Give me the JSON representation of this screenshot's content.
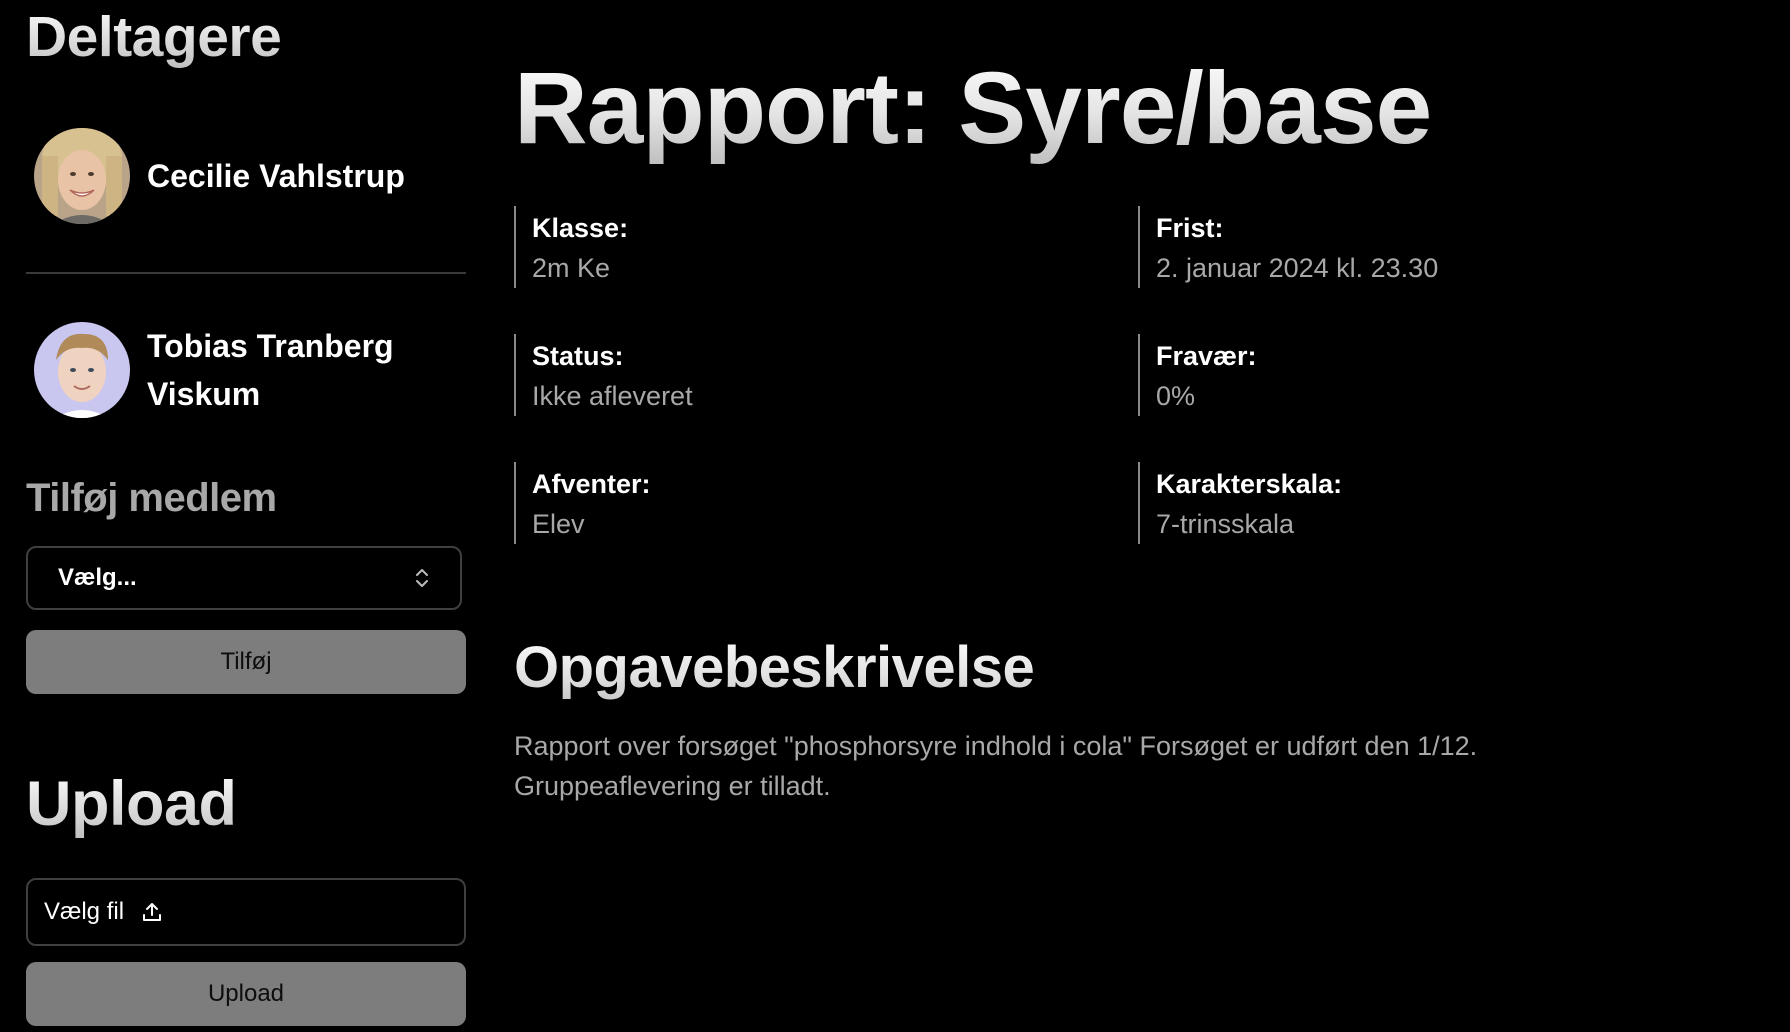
{
  "sidebar": {
    "participants_title": "Deltagere",
    "members": [
      {
        "name": "Cecilie Vahlstrup"
      },
      {
        "name": "Tobias Tranberg Viskum"
      }
    ],
    "add_member_title": "Tilføj medlem",
    "select_value": "Vælg...",
    "add_button": "Tilføj",
    "upload_title": "Upload",
    "file_label": "Vælg fil",
    "upload_button": "Upload"
  },
  "main": {
    "title": "Rapport: Syre/base",
    "info": [
      {
        "label": "Klasse:",
        "value": "2m Ke"
      },
      {
        "label": "Frist:",
        "value": "2. januar 2024 kl. 23.30"
      },
      {
        "label": "Status:",
        "value": "Ikke afleveret"
      },
      {
        "label": "Fravær:",
        "value": "0%"
      },
      {
        "label": "Afventer:",
        "value": "Elev"
      },
      {
        "label": "Karakterskala:",
        "value": "7-trinsskala"
      }
    ],
    "description_title": "Opgavebeskrivelse",
    "description_line1": "Rapport over forsøget \"phosphorsyre indhold i cola\" Forsøget er udført den 1/12.",
    "description_line2": "Gruppeaflevering er tilladt."
  },
  "colors": {
    "background": "#000000",
    "muted_text": "#a8a8a8",
    "button_gray": "#7d7d7d",
    "border": "#3f3f3f"
  },
  "icons": {
    "select": "chevron-up-down-icon",
    "file": "upload-icon"
  }
}
